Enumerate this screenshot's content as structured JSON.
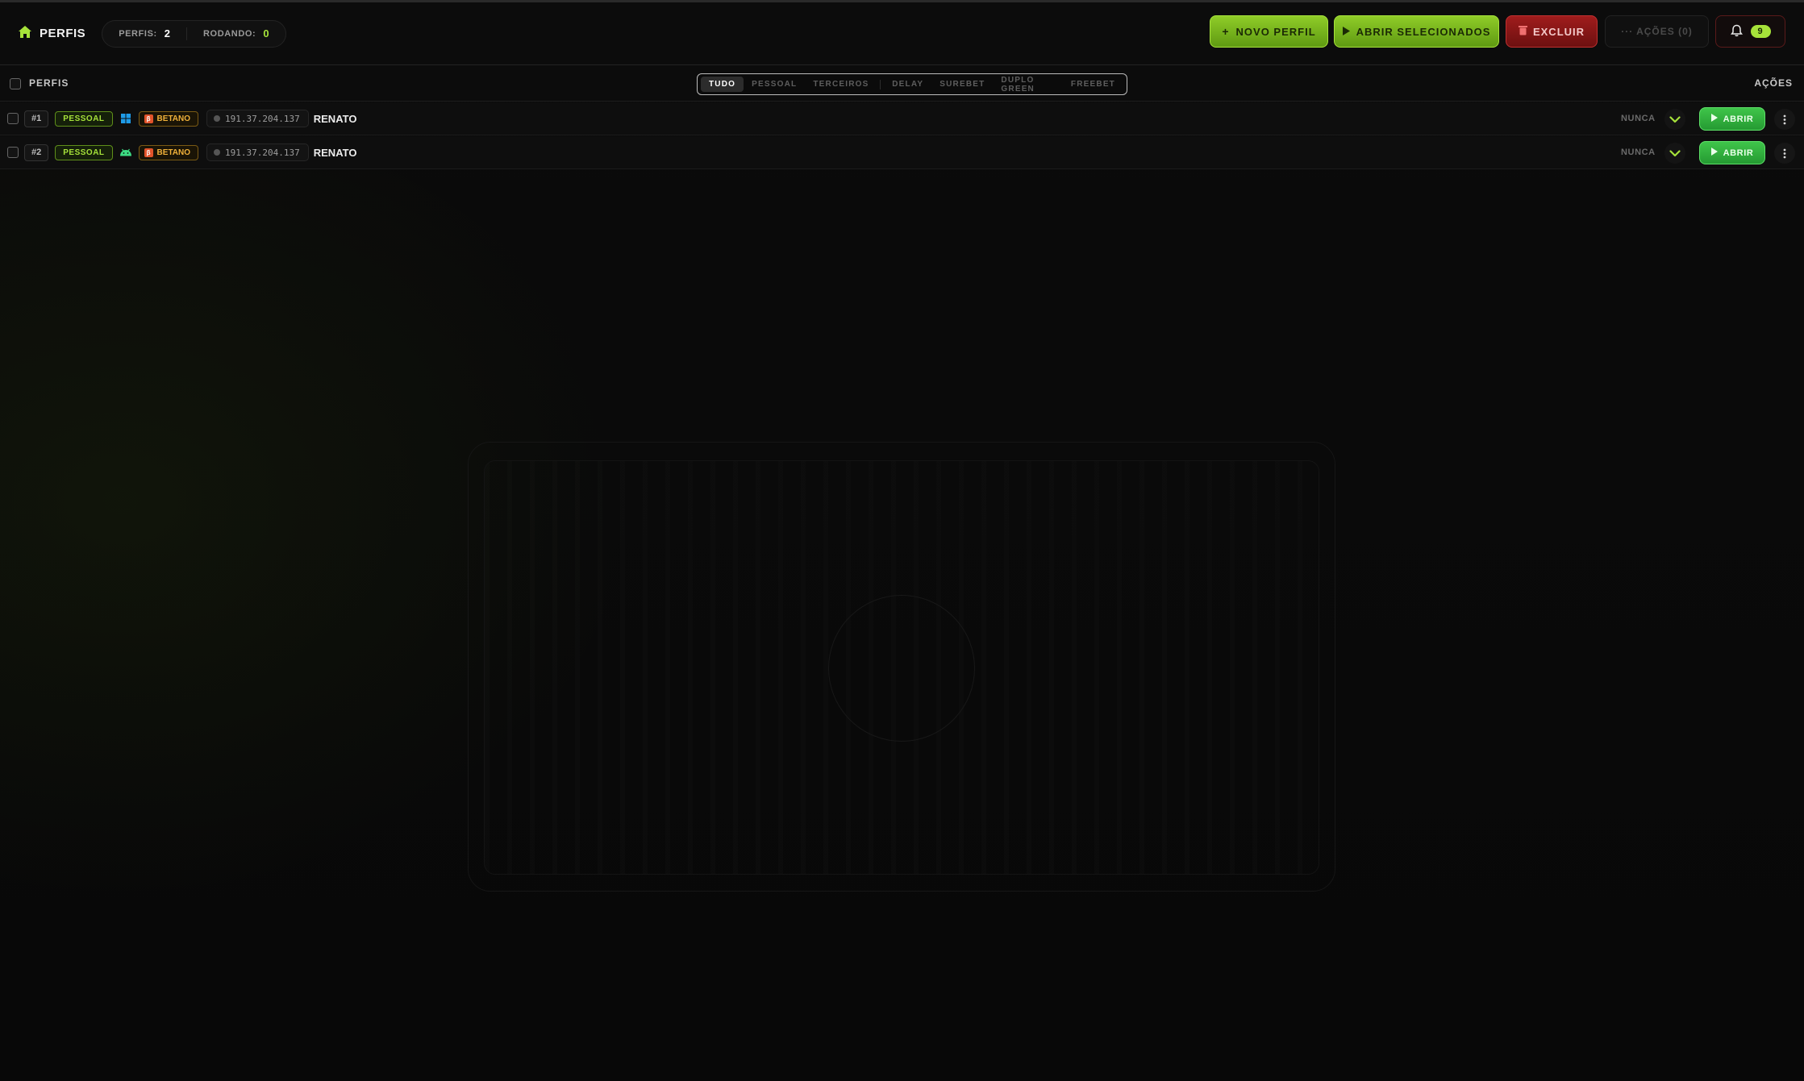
{
  "header": {
    "title": "PERFIS",
    "stats": {
      "perfis_label": "PERFIS:",
      "perfis_value": "2",
      "rodando_label": "RODANDO:",
      "rodando_value": "0"
    },
    "buttons": {
      "novo_perfil": "NOVO PERFIL",
      "abrir_selecionados": "ABRIR SELECIONADOS",
      "excluir": "EXCLUIR",
      "acoes": "··· AÇÕES (0)"
    },
    "notifications_count": "9"
  },
  "table": {
    "select_all_label": "PERFIS",
    "actions_label": "AÇÕES",
    "tabs": [
      {
        "label": "TUDO",
        "active": true
      },
      {
        "label": "PESSOAL"
      },
      {
        "label": "TERCEIROS"
      },
      {
        "label": "DELAY"
      },
      {
        "label": "SUREBET"
      },
      {
        "label": "DUPLO GREEN"
      },
      {
        "label": "FREEBET"
      }
    ],
    "rows": [
      {
        "num": "#1",
        "tag": "PESSOAL",
        "os_icon": "windows-icon",
        "house": "BETANO",
        "ip": "191.37.204.137",
        "name": "RENATO",
        "last_run": "NUNCA",
        "open_label": "ABRIR"
      },
      {
        "num": "#2",
        "tag": "PESSOAL",
        "os_icon": "android-icon",
        "house": "BETANO",
        "ip": "191.37.204.137",
        "name": "RENATO",
        "last_run": "NUNCA",
        "open_label": "ABRIR"
      }
    ]
  },
  "colors": {
    "accent_green": "#a6e23a",
    "open_green": "#3fc54a",
    "danger_red": "#a01c1c",
    "house_orange": "#f0b13a",
    "windows_blue": "#1e9be8",
    "android_green": "#3ddc84"
  }
}
